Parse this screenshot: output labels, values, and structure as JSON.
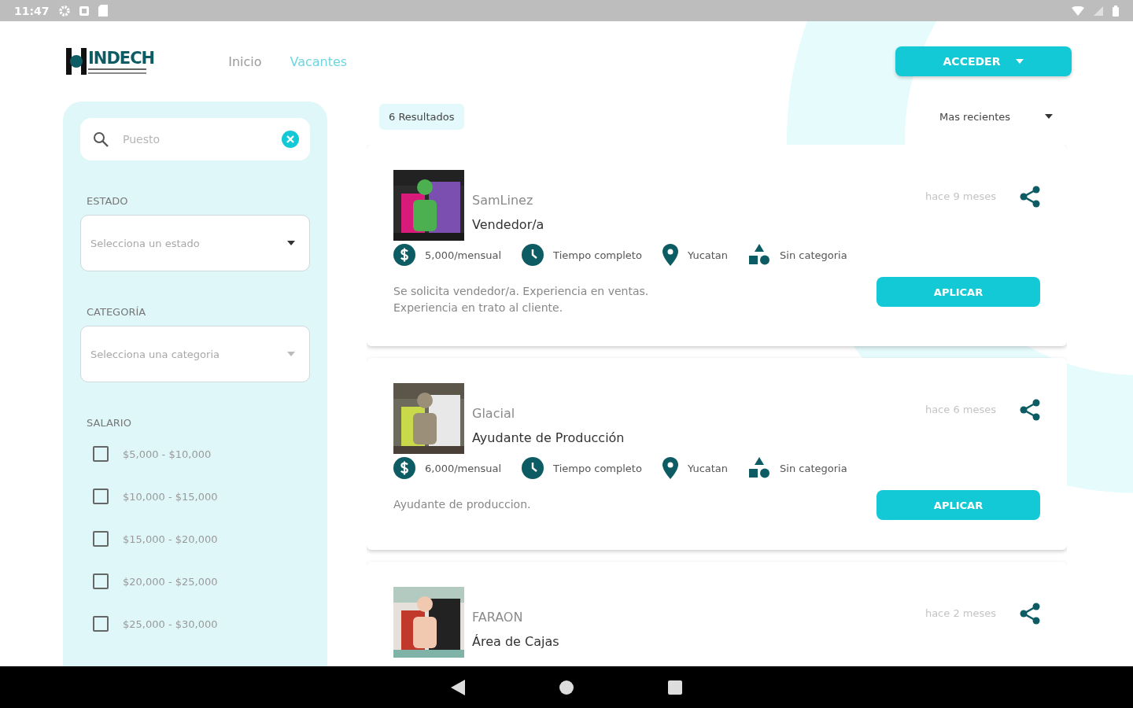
{
  "status_bar": {
    "time": "11:47"
  },
  "header": {
    "logo": "INDECH",
    "nav": [
      {
        "label": "Inicio",
        "selected": false
      },
      {
        "label": "Vacantes",
        "selected": true
      }
    ],
    "login_button": "ACCEDER"
  },
  "filters": {
    "search": {
      "placeholder": "Puesto"
    },
    "state": {
      "label": "ESTADO",
      "placeholder": "Selecciona un estado"
    },
    "category": {
      "label": "CATEGORÍA",
      "placeholder": "Selecciona una categoria"
    },
    "salary": {
      "label": "SALARIO",
      "options": [
        {
          "label": "$5,000 - $10,000",
          "checked": false
        },
        {
          "label": "$10,000 - $15,000",
          "checked": false
        },
        {
          "label": "$15,000 - $20,000",
          "checked": false
        },
        {
          "label": "$20,000 - $25,000",
          "checked": false
        },
        {
          "label": "$25,000 - $30,000",
          "checked": false
        }
      ]
    }
  },
  "results": {
    "count": "6 Resultados",
    "sort": "Mas recientes"
  },
  "jobs": [
    {
      "company": "SamLinez",
      "title": "Vendedor/a",
      "posted": "hace 9 meses",
      "meta": [
        {
          "kind": "salary",
          "text": "5,000/mensual"
        },
        {
          "kind": "schedule",
          "text": "Tiempo completo"
        },
        {
          "kind": "location",
          "text": "Yucatan"
        },
        {
          "kind": "category",
          "text": "Sin categoria"
        }
      ],
      "description": "Se solicita vendedor/a. Experiencia en ventas. Experiencia en trato al cliente.",
      "apply": "APLICAR"
    },
    {
      "company": "Glacial",
      "title": "Ayudante de Producción",
      "posted": "hace 6 meses",
      "meta": [
        {
          "kind": "salary",
          "text": "6,000/mensual"
        },
        {
          "kind": "schedule",
          "text": "Tiempo completo"
        },
        {
          "kind": "location",
          "text": "Yucatan"
        },
        {
          "kind": "category",
          "text": "Sin categoria"
        }
      ],
      "description": "Ayudante de produccion.",
      "apply": "APLICAR"
    },
    {
      "company": "FARAON",
      "title": "Área de Cajas",
      "posted": "hace 2 meses"
    }
  ]
}
